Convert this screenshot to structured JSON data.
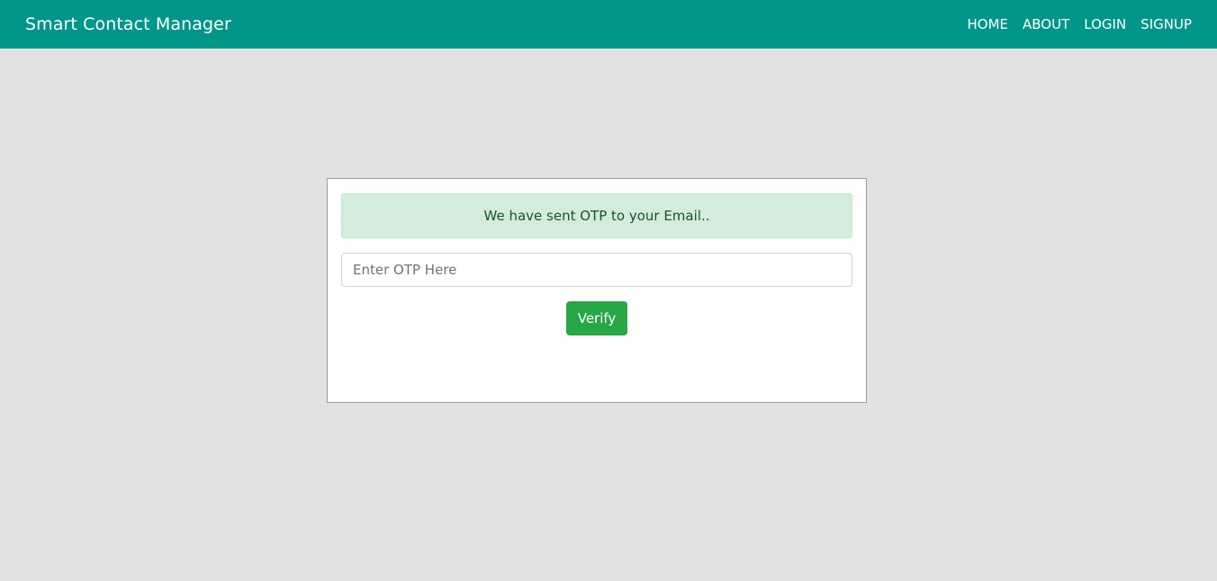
{
  "navbar": {
    "brand": "Smart Contact Manager",
    "links": [
      {
        "label": "HOME"
      },
      {
        "label": "ABOUT"
      },
      {
        "label": "LOGIN"
      },
      {
        "label": "SIGNUP"
      }
    ]
  },
  "otp_card": {
    "alert_message": "We have sent OTP to your Email..",
    "otp_input": {
      "value": "",
      "placeholder": "Enter OTP Here"
    },
    "verify_label": "Verify"
  },
  "colors": {
    "navbar_bg": "#009688",
    "page_bg": "#e2e2e2",
    "alert_bg": "#d4ecdb",
    "alert_text": "#155724",
    "verify_button": "#28a745"
  }
}
